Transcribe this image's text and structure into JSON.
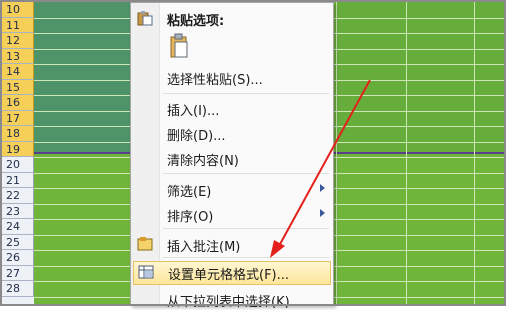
{
  "rows": [
    "10",
    "11",
    "12",
    "13",
    "14",
    "15",
    "16",
    "17",
    "18",
    "19",
    "20",
    "21",
    "22",
    "23",
    "24",
    "25",
    "26",
    "27",
    "28"
  ],
  "selected_rows": [
    "10",
    "11",
    "12",
    "13",
    "14",
    "15",
    "16",
    "17",
    "18",
    "19"
  ],
  "colors": {
    "cell_green": "#6fb53a",
    "selection_fill": "#4f9368",
    "row_header_selected": "#f6cf58",
    "annotation_arrow": "#e3201b"
  },
  "menu": {
    "paste_heading": "粘贴选项:",
    "paste_special": "选择性粘贴(S)...",
    "insert": "插入(I)...",
    "delete": "删除(D)...",
    "clear_contents": "清除内容(N)",
    "filter": "筛选(E)",
    "sort": "排序(O)",
    "insert_comment": "插入批注(M)",
    "format_cells": "设置单元格格式(F)...",
    "pick_from_list": "从下拉列表中选择(K)..."
  }
}
